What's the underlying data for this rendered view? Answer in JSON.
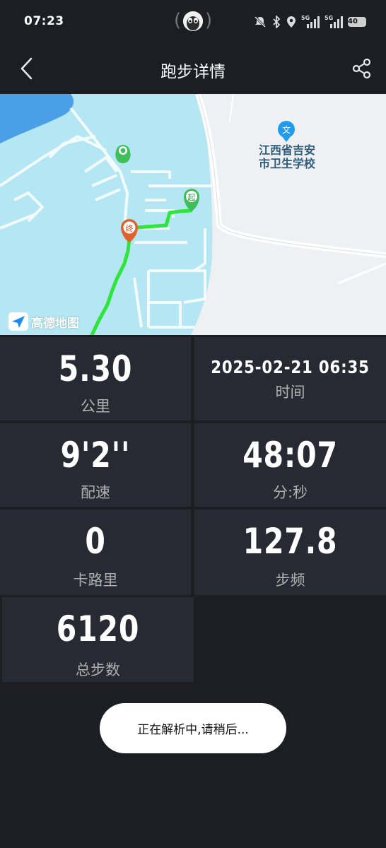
{
  "status_bar": {
    "time": "07:23",
    "network_1": "5G",
    "network_2": "5G",
    "battery": "40",
    "icons": [
      "mute-icon",
      "bluetooth-icon",
      "location-icon",
      "signal-icon",
      "signal-icon",
      "battery-icon"
    ]
  },
  "header": {
    "title": "跑步详情",
    "back_icon": "chevron-left-icon",
    "share_icon": "share-icon"
  },
  "map": {
    "provider_logo_text": "高德地图",
    "poi_icon_text": "文",
    "poi_name": "江西省吉安市卫生学校",
    "start_marker": "起",
    "end_marker": "终",
    "route_color": "#2ee63a"
  },
  "stats": [
    {
      "value": "5.30",
      "label": "公里"
    },
    {
      "value": "2025-02-21 06:35",
      "label": "时间"
    },
    {
      "value": "9'2''",
      "label": "配速"
    },
    {
      "value": "48:07",
      "label": "分:秒"
    },
    {
      "value": "0",
      "label": "卡路里"
    },
    {
      "value": "127.8",
      "label": "步频"
    },
    {
      "value": "6120",
      "label": "总步数"
    }
  ],
  "toast": {
    "text": "正在解析中,请稍后..."
  },
  "colors": {
    "background": "#1c1e24",
    "card": "#272a33",
    "map_water": "#b5e6f3",
    "map_land": "#eef0f3"
  }
}
